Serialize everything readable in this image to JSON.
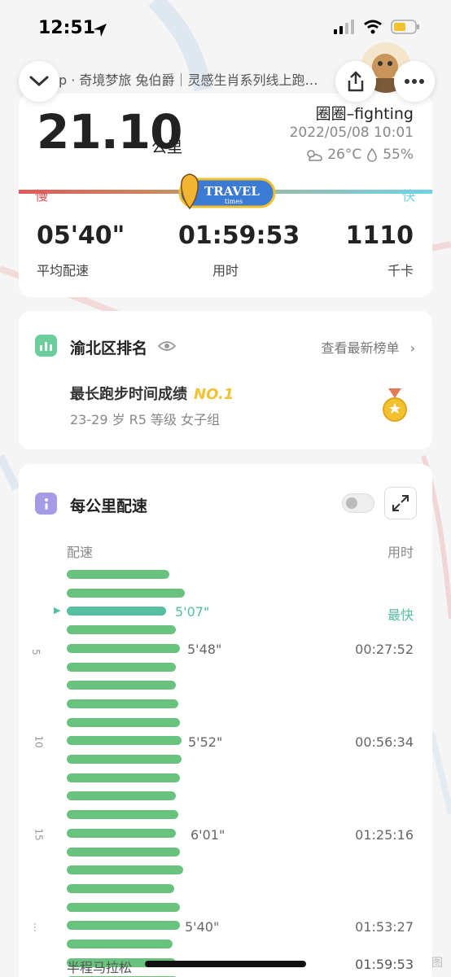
{
  "status_bar": {
    "time": "12:51"
  },
  "header": {
    "ticker": "p · 奇境梦旅 兔伯爵｜灵感生肖系列线上跑…",
    "user_name": "圈圈–fighting",
    "date": "2022/05/08 10:01",
    "temperature": "26°C",
    "humidity": "55%"
  },
  "summary": {
    "distance": "21.10",
    "distance_unit": "公里",
    "slow_label": "慢",
    "fast_label": "快",
    "badge_text": "TRAVEL",
    "badge_sub": "times",
    "stats": [
      {
        "value": "05'40\"",
        "label": "平均配速"
      },
      {
        "value": "01:59:53",
        "label": "用时"
      },
      {
        "value": "1110",
        "label": "千卡"
      }
    ]
  },
  "ranking": {
    "title": "渝北区排名",
    "link": "查看最新榜单",
    "achievement": "最长跑步时间成绩",
    "rank": "NO.1",
    "detail": "23-29 岁 R5 等级 女子组"
  },
  "pace": {
    "title": "每公里配速",
    "col_pace": "配速",
    "col_time": "用时",
    "fastest_pace": "5'07\"",
    "fastest_label": "最快",
    "marks": [
      {
        "km": "5",
        "pace": "5'48\"",
        "time": "00:27:52"
      },
      {
        "km": "10",
        "pace": "5'52\"",
        "time": "00:56:34"
      },
      {
        "km": "15",
        "pace": "6'01\"",
        "time": "01:25:16"
      },
      {
        "km": "…",
        "pace": "5'40\"",
        "time": "01:53:27"
      }
    ],
    "bar_levels": [
      0.6,
      0.69,
      0.58,
      0.64,
      0.66,
      0.64,
      0.64,
      0.65,
      0.66,
      0.67,
      0.67,
      0.66,
      0.64,
      0.65,
      0.64,
      0.66,
      0.68,
      0.63,
      0.66,
      0.66,
      0.62,
      0.64,
      0.65
    ],
    "footer_label": "半程马拉松",
    "footer_time": "01:59:53"
  },
  "watermark": "图"
}
